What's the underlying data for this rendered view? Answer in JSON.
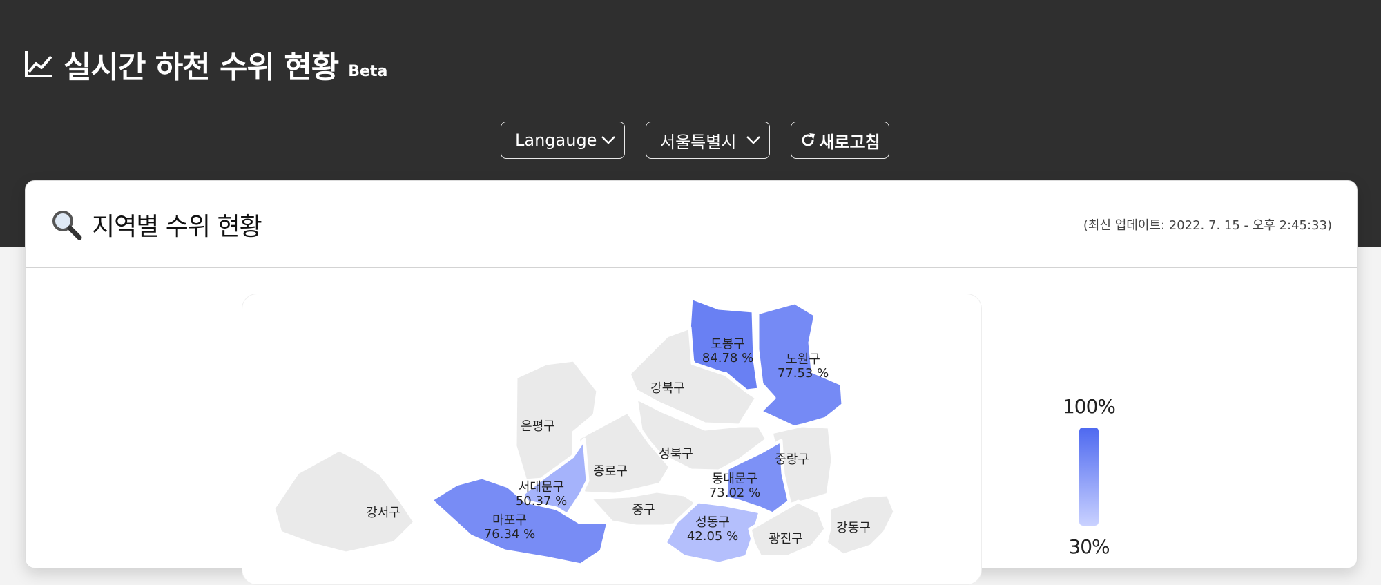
{
  "header": {
    "title": "실시간 하천 수위 현황",
    "badge": "Beta"
  },
  "controls": {
    "language_label": "Langauge",
    "region_label": "서울특별시",
    "refresh_label": "새로고침"
  },
  "section": {
    "title": "지역별 수위 현황",
    "updated": "(최신 업데이트: 2022. 7. 15 - 오후 2:45:33)"
  },
  "colors": {
    "topbar": "#2f2f2f",
    "high": "#4e69f0",
    "low": "#c9d1ff",
    "neutral": "#eaeaea"
  },
  "districts": [
    {
      "name": "도봉구",
      "value": "84.78 %",
      "level": 84.78
    },
    {
      "name": "노원구",
      "value": "77.53 %",
      "level": 77.53
    },
    {
      "name": "강북구",
      "value": "",
      "level": null
    },
    {
      "name": "은평구",
      "value": "",
      "level": null
    },
    {
      "name": "성북구",
      "value": "",
      "level": null
    },
    {
      "name": "종로구",
      "value": "",
      "level": null
    },
    {
      "name": "중랑구",
      "value": "",
      "level": null
    },
    {
      "name": "서대문구",
      "value": "50.37 %",
      "level": 50.37
    },
    {
      "name": "동대문구",
      "value": "73.02 %",
      "level": 73.02
    },
    {
      "name": "강서구",
      "value": "",
      "level": null
    },
    {
      "name": "마포구",
      "value": "76.34 %",
      "level": 76.34
    },
    {
      "name": "중구",
      "value": "",
      "level": null
    },
    {
      "name": "성동구",
      "value": "42.05 %",
      "level": 42.05
    },
    {
      "name": "광진구",
      "value": "",
      "level": null
    },
    {
      "name": "강동구",
      "value": "",
      "level": null
    }
  ],
  "legend": {
    "max": "100%",
    "min": "30%"
  }
}
